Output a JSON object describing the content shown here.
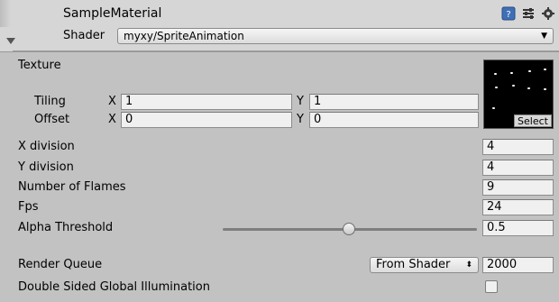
{
  "header": {
    "material_name": "SampleMaterial",
    "shader_label": "Shader",
    "shader_value": "myxy/SpriteAnimation",
    "icons": [
      "book-help-icon",
      "preset-sliders-icon",
      "gear-icon",
      "foldout-arrow-icon",
      "material-sphere-icon"
    ]
  },
  "texture": {
    "label": "Texture",
    "select_label": "Select",
    "tiling_label": "Tiling",
    "offset_label": "Offset",
    "x_label": "X",
    "y_label": "Y",
    "tiling_x": "1",
    "tiling_y": "1",
    "offset_x": "0",
    "offset_y": "0"
  },
  "properties": {
    "x_division_label": "X division",
    "x_division_value": "4",
    "y_division_label": "Y division",
    "y_division_value": "4",
    "flames_label": "Number of Flames",
    "flames_value": "9",
    "fps_label": "Fps",
    "fps_value": "24",
    "alpha_label": "Alpha Threshold",
    "alpha_value": "0.5",
    "alpha_slider_level": 0.5,
    "render_queue_label": "Render Queue",
    "render_queue_option": "From Shader",
    "render_queue_value": "2000",
    "dsgi_label": "Double Sided Global Illumination",
    "dsgi_checked": false
  },
  "colors": {
    "panel_bg": "#c2c2c2",
    "header_bg": "#d6d6d6",
    "field_bg": "#f0f0f0"
  }
}
